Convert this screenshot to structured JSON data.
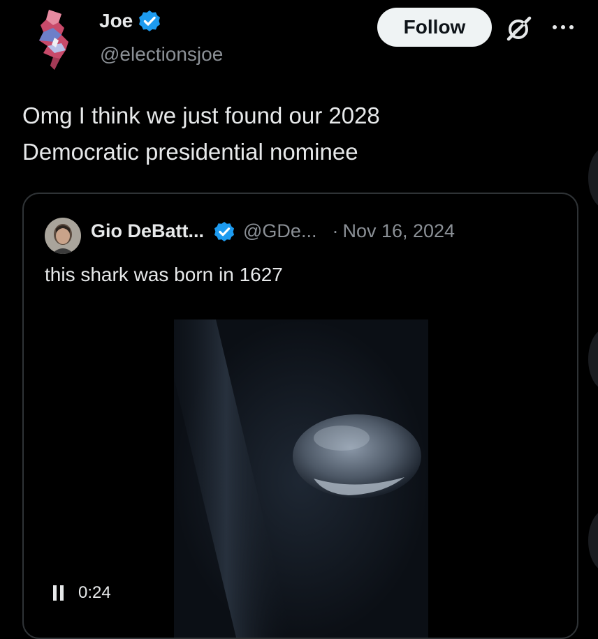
{
  "author": {
    "display_name": "Joe",
    "handle": "@electionsjoe",
    "verified_icon": "verified-badge-icon",
    "avatar_icon": "new-jersey-map-avatar"
  },
  "actions": {
    "follow_label": "Follow",
    "grok_icon": "grok-icon",
    "more_icon": "more-options-icon"
  },
  "tweet": {
    "text_line1": "Omg I think we just found our 2028",
    "text_line2": "Democratic presidential nominee"
  },
  "quote": {
    "display_name": "Gio DeBatt...",
    "handle": "@GDe...",
    "separator": "·",
    "date": "Nov 16, 2024",
    "text": "this shark was born in 1627",
    "video": {
      "state_icon": "pause-icon",
      "timestamp": "0:24"
    }
  },
  "colors": {
    "background": "#000000",
    "text_primary": "#e7e9ea",
    "text_secondary": "#8b9096",
    "verified_blue": "#1d9bf0",
    "border": "#2f3336",
    "follow_bg": "#eff3f4"
  }
}
